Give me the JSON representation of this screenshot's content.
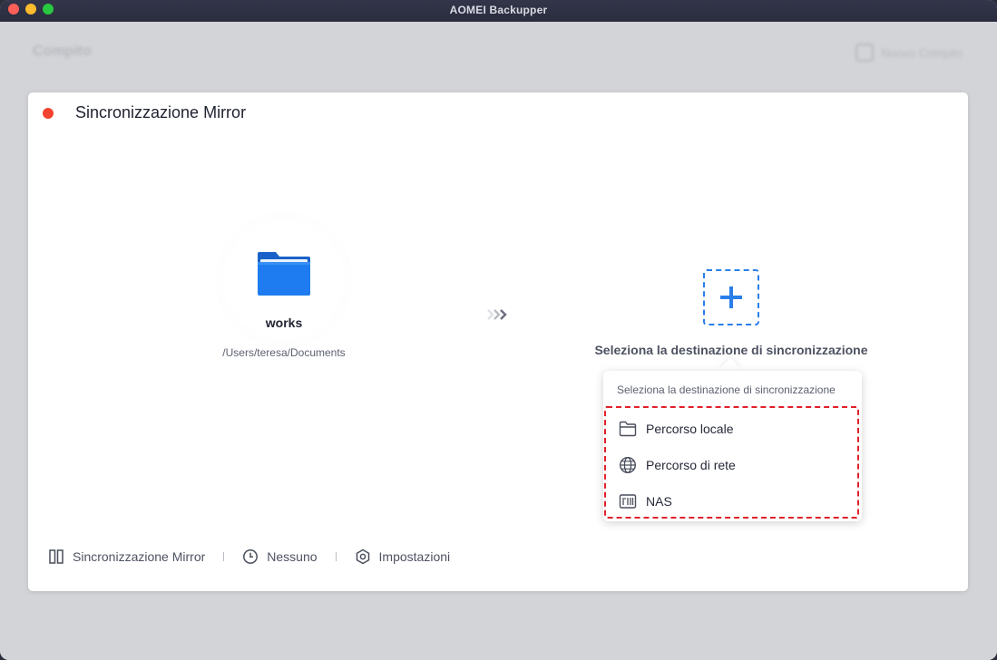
{
  "window": {
    "title": "AOMEI Backupper"
  },
  "background": {
    "page_title": "Compito",
    "new_task_label": "Nuovo Compito"
  },
  "card": {
    "title": "Sincronizzazione Mirror",
    "status_color": "#f4432f"
  },
  "source": {
    "name": "works",
    "path": "/Users/teresa/Documents",
    "icon": "folder-icon"
  },
  "destination": {
    "label": "Seleziona la destinazione di sincronizzazione",
    "icon": "plus-icon",
    "accent_color": "#2a7fea"
  },
  "popup": {
    "header": "Seleziona la destinazione di sincronizzazione",
    "items": [
      {
        "label": "Percorso locale",
        "icon": "folder-outline-icon"
      },
      {
        "label": "Percorso di rete",
        "icon": "globe-icon"
      },
      {
        "label": "NAS",
        "icon": "nas-icon"
      }
    ],
    "highlight_color": "#e0202a"
  },
  "bottombar": {
    "mode_label": "Sincronizzazione Mirror",
    "schedule_label": "Nessuno",
    "settings_label": "Impostazioni"
  }
}
